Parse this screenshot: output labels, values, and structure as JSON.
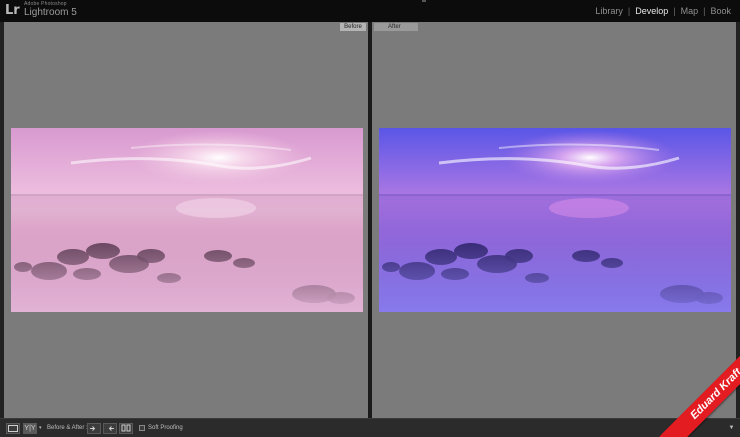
{
  "app": {
    "logo": "Lr",
    "brand_small": "Adobe Photoshop",
    "brand_name": "Lightroom 5"
  },
  "modules": [
    {
      "label": "Library",
      "active": false
    },
    {
      "label": "Develop",
      "active": true
    },
    {
      "label": "Map",
      "active": false
    },
    {
      "label": "Book",
      "active": false
    }
  ],
  "compare": {
    "before_label": "Before",
    "after_label": "After"
  },
  "toolbar": {
    "view_loupe_icon": "loupe-icon",
    "view_yy_label": "Y|Y",
    "mode_label": "Before & After :",
    "soft_proofing_label": "Soft Proofing",
    "soft_proofing_checked": false,
    "dropdown_icon": "triangle-down-icon"
  },
  "watermark": {
    "text": "Eduard Kraft"
  },
  "colors": {
    "before_sky": "#e9b8dc",
    "after_sky": "#6a5ee8",
    "watermark": "#e31c22"
  }
}
